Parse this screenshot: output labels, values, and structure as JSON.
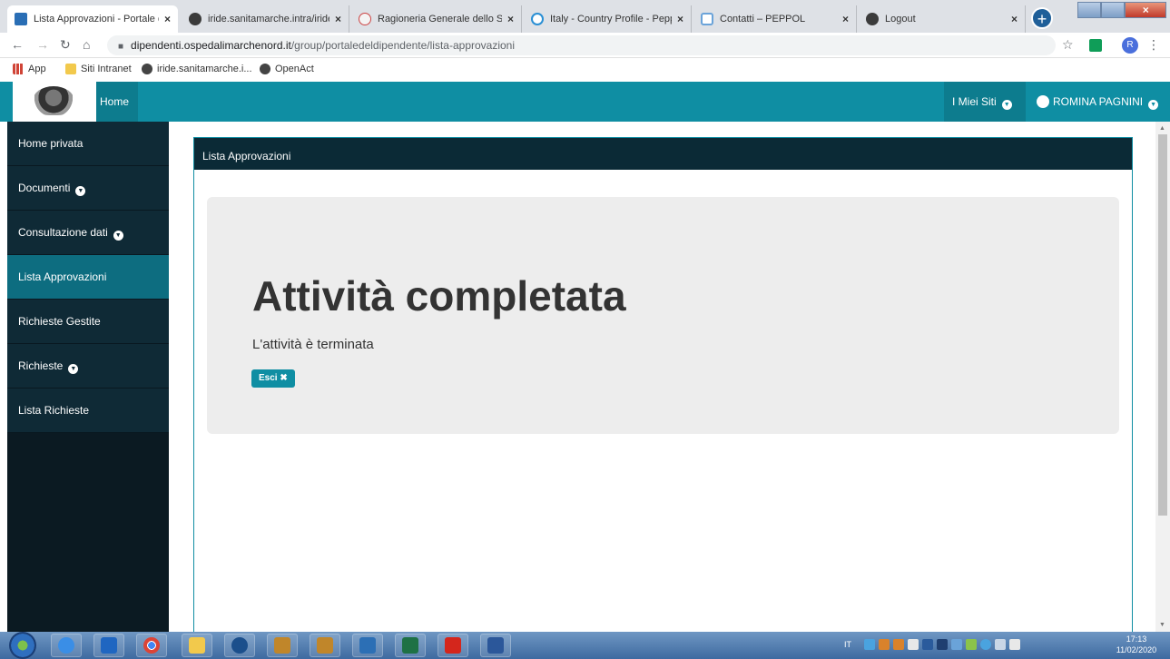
{
  "browser": {
    "tabs": [
      {
        "title": "Lista Approvazioni - Portale d",
        "icon": "liferay",
        "active": true
      },
      {
        "title": "iride.sanitamarche.intra/iride/",
        "icon": "globe",
        "active": false
      },
      {
        "title": "Ragioneria Generale dello Sta",
        "icon": "rgs",
        "active": false
      },
      {
        "title": "Italy - Country Profile - Peppo",
        "icon": "peppol",
        "active": false
      },
      {
        "title": "Contatti – PEPPOL",
        "icon": "contatti",
        "active": false
      },
      {
        "title": "Logout",
        "icon": "globe",
        "active": false
      }
    ],
    "tab_close_glyph": "×",
    "new_tab_glyph": "+",
    "close_window_glyph": "×",
    "url_host": "dipendenti.ospedalimarchenord.it",
    "url_path": "/group/portaledeldipendente/lista-approvazioni",
    "profile_initial": "R",
    "bookmarks": [
      {
        "label": "App",
        "icon": "apps"
      },
      {
        "label": "Siti Intranet",
        "icon": "folder"
      },
      {
        "label": "iride.sanitamarche.i...",
        "icon": "globe"
      },
      {
        "label": "OpenAct",
        "icon": "globe"
      }
    ]
  },
  "portal": {
    "home_label": "Home",
    "my_sites_label": "I Miei Siti",
    "user_name": "ROMINA PAGNINI",
    "accent_color": "#0f8ea3",
    "dark_color": "#0b2a36"
  },
  "sidebar": {
    "items": [
      {
        "label": "Home privata",
        "has_caret": false,
        "active": false
      },
      {
        "label": "Documenti",
        "has_caret": true,
        "active": false
      },
      {
        "label": "Consultazione dati",
        "has_caret": true,
        "active": false
      },
      {
        "label": "Lista Approvazioni",
        "has_caret": false,
        "active": true
      },
      {
        "label": "Richieste Gestite",
        "has_caret": false,
        "active": false
      },
      {
        "label": "Richieste",
        "has_caret": true,
        "active": false
      },
      {
        "label": "Lista Richieste",
        "has_caret": false,
        "active": false
      }
    ]
  },
  "main": {
    "panel_title": "Lista Approvazioni",
    "heading": "Attività completata",
    "message": "L'attività è terminata",
    "exit_button_label": "Esci ✖"
  },
  "taskbar": {
    "language": "IT",
    "time": "17:13",
    "date": "11/02/2020"
  }
}
